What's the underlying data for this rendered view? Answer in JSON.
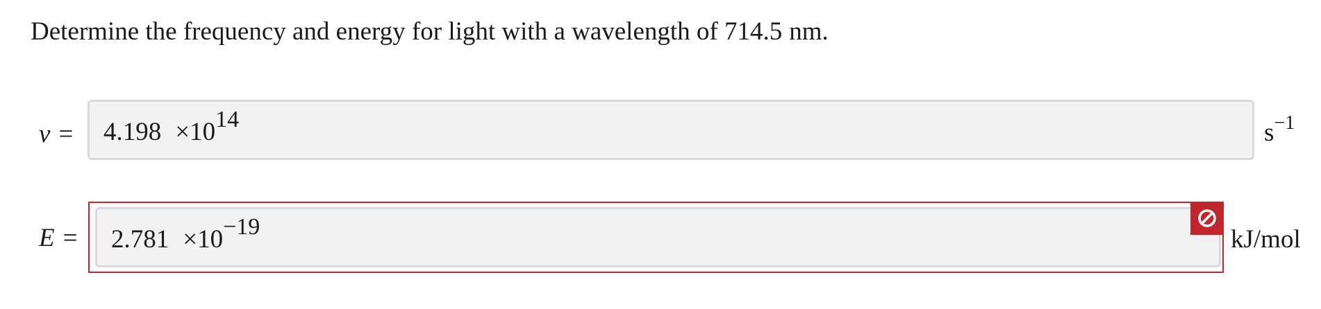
{
  "question": {
    "text": "Determine the frequency and energy for light with a wavelength of 714.5",
    "unit": "nm",
    "end": "."
  },
  "frequency": {
    "symbol": "ν",
    "equals": "=",
    "mantissa": "4.198",
    "times": "×10",
    "exponent": "14",
    "unit_base": "s",
    "unit_exponent": "−1"
  },
  "energy": {
    "symbol": "E",
    "equals": "=",
    "mantissa": "2.781",
    "times": "×10",
    "exponent": "−19",
    "unit": "kJ/mol",
    "status": "incorrect",
    "status_icon": "prohibited-icon",
    "status_color": "#c0272d"
  }
}
